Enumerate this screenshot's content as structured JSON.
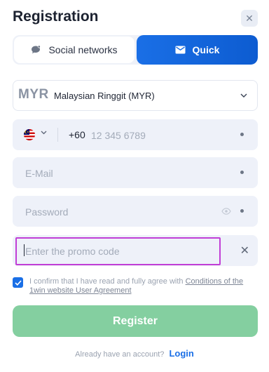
{
  "modal": {
    "title": "Registration",
    "close_symbol": "✕"
  },
  "tabs": [
    {
      "label": "Social networks",
      "icon": "chat-bubble-icon",
      "active": false
    },
    {
      "label": "Quick",
      "icon": "envelope-icon",
      "active": true
    }
  ],
  "currency": {
    "code": "MYR",
    "name": "Malaysian Ringgit (MYR)",
    "chevron": "⌄"
  },
  "phone": {
    "country": "Malaysia",
    "dial_code": "+60",
    "placeholder": "12 345 6789",
    "chevron": "⌄"
  },
  "email": {
    "placeholder": "E-Mail"
  },
  "password": {
    "placeholder": "Password"
  },
  "promo": {
    "placeholder": "Enter the promo code",
    "clear_symbol": "✕"
  },
  "agreement": {
    "checked": true,
    "text": "I confirm that I have read and fully agree with",
    "link": "Conditions of the 1win website User Agreement"
  },
  "register_label": "Register",
  "footer": {
    "prompt": "Already have an account?",
    "login_label": "Login"
  },
  "colors": {
    "accent": "#1a6fe6",
    "register_bg": "#84cfa0",
    "field_bg": "#eef1f9",
    "promo_highlight": "#c13ed6"
  }
}
